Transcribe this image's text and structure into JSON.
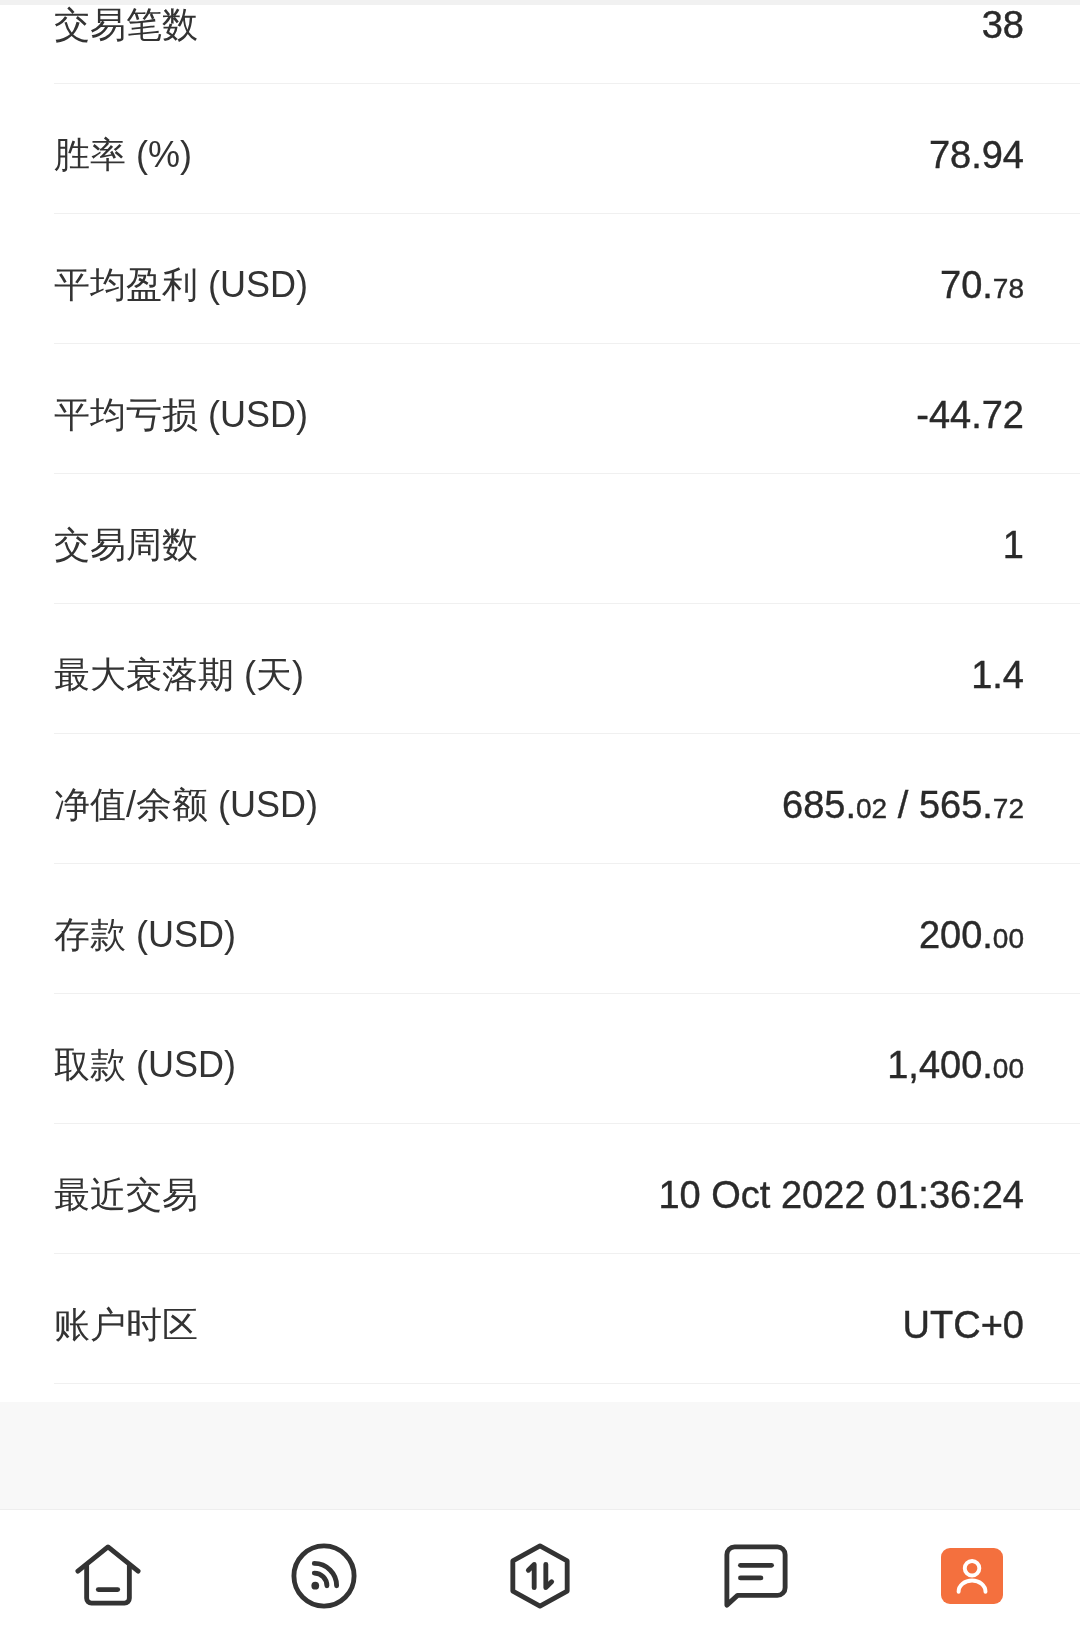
{
  "stats": [
    {
      "label": "交易笔数",
      "value": [
        {
          "text": "38",
          "small": false
        }
      ]
    },
    {
      "label": "胜率 (%)",
      "value": [
        {
          "text": "78.94",
          "small": false
        }
      ]
    },
    {
      "label": "平均盈利 (USD)",
      "value": [
        {
          "text": "70.",
          "small": false
        },
        {
          "text": "78",
          "small": true
        }
      ]
    },
    {
      "label": "平均亏损 (USD)",
      "value": [
        {
          "text": "-44.72",
          "small": false
        }
      ]
    },
    {
      "label": "交易周数",
      "value": [
        {
          "text": "1",
          "small": false
        }
      ]
    },
    {
      "label": "最大衰落期 (天)",
      "value": [
        {
          "text": "1.4",
          "small": false
        }
      ]
    },
    {
      "label": "净值/余额 (USD)",
      "value": [
        {
          "text": "685.",
          "small": false
        },
        {
          "text": "02",
          "small": true
        },
        {
          "text": " / 565.",
          "small": false
        },
        {
          "text": "72",
          "small": true
        }
      ]
    },
    {
      "label": "存款 (USD)",
      "value": [
        {
          "text": "200.",
          "small": false
        },
        {
          "text": "00",
          "small": true
        }
      ]
    },
    {
      "label": "取款 (USD)",
      "value": [
        {
          "text": "1,400.",
          "small": false
        },
        {
          "text": "00",
          "small": true
        }
      ]
    },
    {
      "label": "最近交易",
      "value": [
        {
          "text": "10 Oct 2022 01:36:24",
          "small": false
        }
      ]
    },
    {
      "label": "账户时区",
      "value": [
        {
          "text": "UTC+0",
          "small": false
        }
      ]
    }
  ],
  "nav": [
    {
      "selected": false
    },
    {
      "selected": false
    },
    {
      "selected": false
    },
    {
      "selected": false
    },
    {
      "selected": true
    }
  ]
}
